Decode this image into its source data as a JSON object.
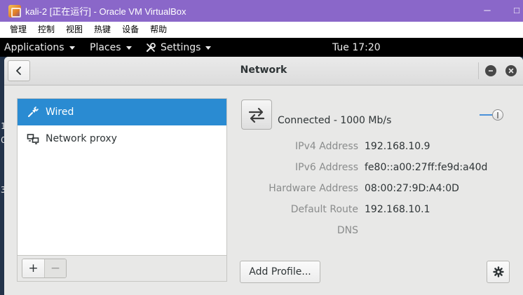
{
  "vbox": {
    "title": "kali-2 [正在运行] - Oracle VM VirtualBox",
    "minimize_glyph": "□",
    "maximize_glyph": "□",
    "menu": [
      "管理",
      "控制",
      "视图",
      "热键",
      "设备",
      "帮助"
    ]
  },
  "topbar": {
    "applications": "Applications",
    "places": "Places",
    "settings": "Settings",
    "clock": "Tue 17:20"
  },
  "desktop": {
    "edge_chars": [
      "1",
      "C",
      "3"
    ]
  },
  "window": {
    "title": "Network",
    "back_icon": "chevron-left-icon",
    "minimize_icon": "minimize-icon",
    "close_icon": "close-icon"
  },
  "sidebar": {
    "items": [
      {
        "label": "Wired",
        "icon": "wired-plug-icon",
        "selected": true
      },
      {
        "label": "Network proxy",
        "icon": "network-proxy-icon",
        "selected": false
      }
    ],
    "add_label": "+",
    "remove_label": "−"
  },
  "connection": {
    "status": "Connected - 1000 Mb/s",
    "toggle_on": true
  },
  "details": [
    {
      "label": "IPv4 Address",
      "value": "192.168.10.9"
    },
    {
      "label": "IPv6 Address",
      "value": "fe80::a00:27ff:fe9d:a40d"
    },
    {
      "label": "Hardware Address",
      "value": "08:00:27:9D:A4:0D"
    },
    {
      "label": "Default Route",
      "value": "192.168.10.1"
    },
    {
      "label": "DNS",
      "value": ""
    }
  ],
  "actions": {
    "add_profile": "Add Profile...",
    "options_icon": "gear-icon"
  },
  "colors": {
    "vbox_title_bg": "#8a67c9",
    "selection": "#2a8bd2",
    "toggle_accent": "#4a90d9"
  }
}
